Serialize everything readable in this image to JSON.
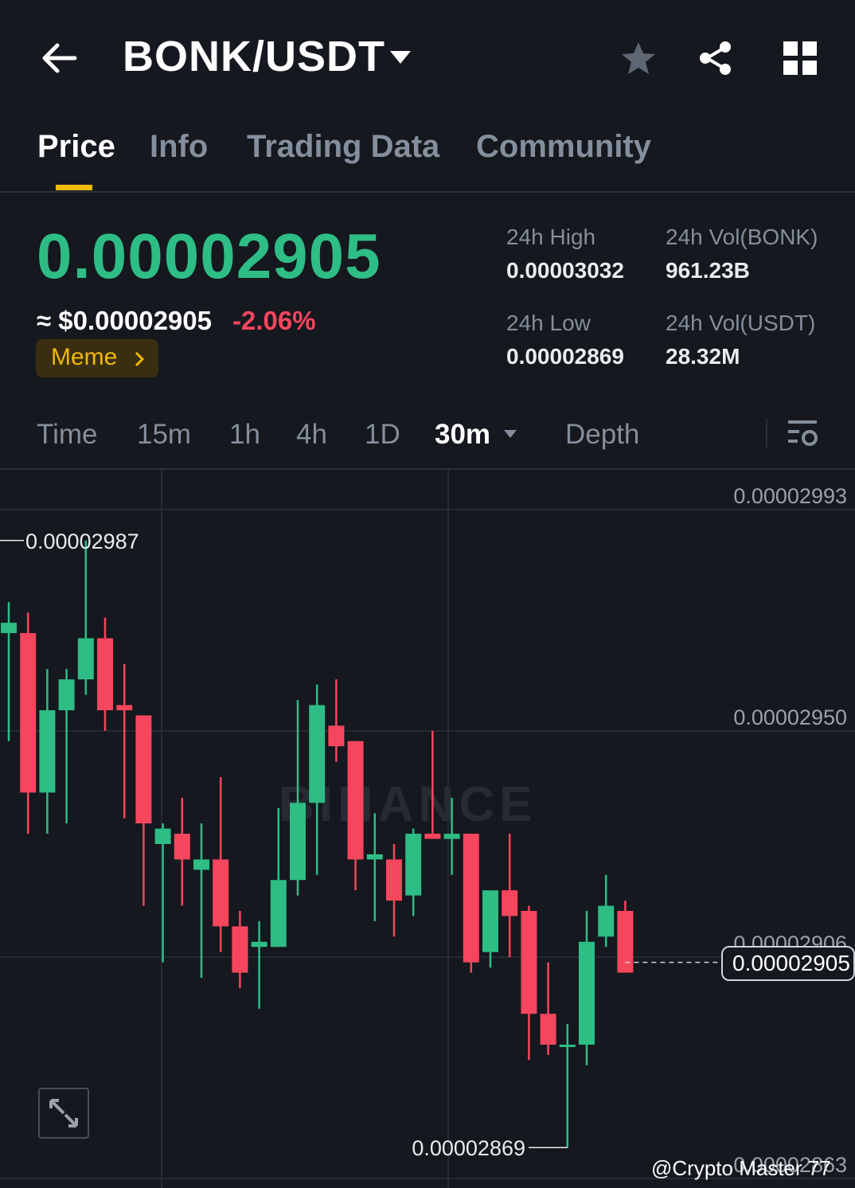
{
  "header": {
    "pair": "BONK/USDT",
    "icons": [
      "back-arrow-icon",
      "caret-down-icon",
      "star-icon",
      "share-icon",
      "grid-icon"
    ]
  },
  "tabs": [
    {
      "label": "Price",
      "active": true
    },
    {
      "label": "Info",
      "active": false
    },
    {
      "label": "Trading Data",
      "active": false
    },
    {
      "label": "Community",
      "active": false
    }
  ],
  "price": {
    "last": "0.00002905",
    "usd": "≈ $0.00002905",
    "change": "-2.06%",
    "tag": "Meme"
  },
  "stats": {
    "high_label": "24h High",
    "high_value": "0.00003032",
    "low_label": "24h Low",
    "low_value": "0.00002869",
    "vol_bonk_label": "24h Vol(BONK)",
    "vol_bonk_value": "961.23B",
    "vol_usdt_label": "24h Vol(USDT)",
    "vol_usdt_value": "28.32M"
  },
  "intervals": {
    "items": [
      "Time",
      "15m",
      "1h",
      "4h",
      "1D",
      "30m",
      "Depth"
    ],
    "selected": "30m"
  },
  "watermark": "BINANCE",
  "credit": "@Crypto Master 77",
  "colors": {
    "up": "#2ebd85",
    "down": "#f6465d",
    "accent": "#f0b90b",
    "background": "#15181e"
  },
  "chart_data": {
    "type": "candlestick",
    "y_axis_labels": [
      "0.00002993",
      "0.00002950",
      "0.00002906",
      "0.00002863"
    ],
    "ylim": [
      2.86e-05,
      3.005e-05
    ],
    "grid": true,
    "max_marker": "0.00002987",
    "min_marker": "0.00002869",
    "current_price_label": "0.00002905",
    "current_price": 2.905e-05,
    "candles": [
      {
        "o": 2.969e-05,
        "h": 2.975e-05,
        "l": 2.948e-05,
        "c": 2.971e-05
      },
      {
        "o": 2.969e-05,
        "h": 2.973e-05,
        "l": 2.93e-05,
        "c": 2.938e-05
      },
      {
        "o": 2.938e-05,
        "h": 2.962e-05,
        "l": 2.93e-05,
        "c": 2.954e-05
      },
      {
        "o": 2.954e-05,
        "h": 2.962e-05,
        "l": 2.932e-05,
        "c": 2.96e-05
      },
      {
        "o": 2.96e-05,
        "h": 2.987e-05,
        "l": 2.957e-05,
        "c": 2.968e-05
      },
      {
        "o": 2.968e-05,
        "h": 2.972e-05,
        "l": 2.95e-05,
        "c": 2.954e-05
      },
      {
        "o": 2.955e-05,
        "h": 2.963e-05,
        "l": 2.933e-05,
        "c": 2.954e-05
      },
      {
        "o": 2.953e-05,
        "h": 2.953e-05,
        "l": 2.916e-05,
        "c": 2.932e-05
      },
      {
        "o": 2.928e-05,
        "h": 2.932e-05,
        "l": 2.905e-05,
        "c": 2.931e-05
      },
      {
        "o": 2.93e-05,
        "h": 2.937e-05,
        "l": 2.916e-05,
        "c": 2.925e-05
      },
      {
        "o": 2.923e-05,
        "h": 2.932e-05,
        "l": 2.902e-05,
        "c": 2.925e-05
      },
      {
        "o": 2.925e-05,
        "h": 2.941e-05,
        "l": 2.907e-05,
        "c": 2.912e-05
      },
      {
        "o": 2.912e-05,
        "h": 2.915e-05,
        "l": 2.9e-05,
        "c": 2.903e-05
      },
      {
        "o": 2.908e-05,
        "h": 2.913e-05,
        "l": 2.896e-05,
        "c": 2.909e-05
      },
      {
        "o": 2.908e-05,
        "h": 2.935e-05,
        "l": 2.908e-05,
        "c": 2.921e-05
      },
      {
        "o": 2.921e-05,
        "h": 2.956e-05,
        "l": 2.918e-05,
        "c": 2.936e-05
      },
      {
        "o": 2.936e-05,
        "h": 2.959e-05,
        "l": 2.922e-05,
        "c": 2.955e-05
      },
      {
        "o": 2.951e-05,
        "h": 2.96e-05,
        "l": 2.944e-05,
        "c": 2.947e-05
      },
      {
        "o": 2.948e-05,
        "h": 2.948e-05,
        "l": 2.919e-05,
        "c": 2.925e-05
      },
      {
        "o": 2.925e-05,
        "h": 2.934e-05,
        "l": 2.913e-05,
        "c": 2.926e-05
      },
      {
        "o": 2.925e-05,
        "h": 2.928e-05,
        "l": 2.91e-05,
        "c": 2.917e-05
      },
      {
        "o": 2.918e-05,
        "h": 2.931e-05,
        "l": 2.914e-05,
        "c": 2.93e-05
      },
      {
        "o": 2.93e-05,
        "h": 2.95e-05,
        "l": 2.93e-05,
        "c": 2.929e-05
      },
      {
        "o": 2.929e-05,
        "h": 2.937e-05,
        "l": 2.922e-05,
        "c": 2.93e-05
      },
      {
        "o": 2.93e-05,
        "h": 2.93e-05,
        "l": 2.903e-05,
        "c": 2.905e-05
      },
      {
        "o": 2.907e-05,
        "h": 2.917e-05,
        "l": 2.904e-05,
        "c": 2.919e-05
      },
      {
        "o": 2.919e-05,
        "h": 2.93e-05,
        "l": 2.906e-05,
        "c": 2.914e-05
      },
      {
        "o": 2.915e-05,
        "h": 2.916e-05,
        "l": 2.886e-05,
        "c": 2.895e-05
      },
      {
        "o": 2.895e-05,
        "h": 2.905e-05,
        "l": 2.887e-05,
        "c": 2.889e-05
      },
      {
        "o": 2.889e-05,
        "h": 2.893e-05,
        "l": 2.869e-05,
        "c": 2.889e-05
      },
      {
        "o": 2.889e-05,
        "h": 2.915e-05,
        "l": 2.885e-05,
        "c": 2.909e-05
      },
      {
        "o": 2.91e-05,
        "h": 2.922e-05,
        "l": 2.908e-05,
        "c": 2.916e-05
      },
      {
        "o": 2.915e-05,
        "h": 2.917e-05,
        "l": 2.903e-05,
        "c": 2.903e-05
      }
    ]
  }
}
